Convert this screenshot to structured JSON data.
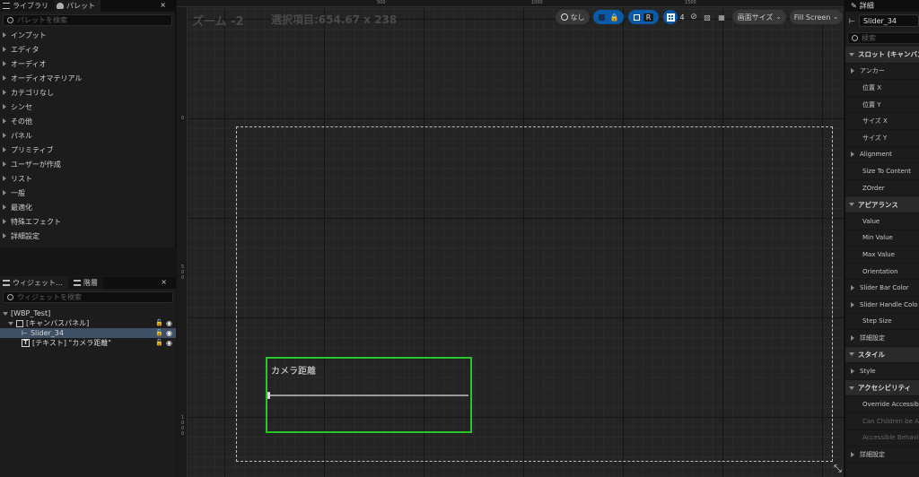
{
  "left_panel": {
    "tabs": {
      "library": "ライブラリ",
      "palette": "パレット",
      "close": "×"
    },
    "search_placeholder": "パレットを検索",
    "categories": [
      "インプット",
      "エディタ",
      "オーディオ",
      "オーディオマテリアル",
      "カテゴリなし",
      "シンセ",
      "その他",
      "パネル",
      "プリミティブ",
      "ユーザーが作成",
      "リスト",
      "一般",
      "最適化",
      "特殊エフェクト",
      "詳細設定"
    ]
  },
  "hierarchy_panel": {
    "tabs": {
      "widgets": "ウィジェット…",
      "hierarchy": "階層",
      "close": "×"
    },
    "search_placeholder": "ウィジェットを検索",
    "tree": {
      "root": "[WBP_Test]",
      "canvas": "[キャンバスパネル]",
      "slider": "Slider_34",
      "text": "[テキスト] \"カメラ距離\""
    }
  },
  "designer": {
    "zoom": "ズーム -2",
    "selection": "選択項目:654.67 x 238",
    "ruler_top": [
      "500",
      "1000",
      "1500"
    ],
    "ruler_left": [
      "0",
      "500",
      "1000"
    ],
    "toolbar": {
      "none": "なし",
      "r": "R",
      "grid_count": "4",
      "screen_size": "画面サイズ",
      "fill_screen": "Fill Screen"
    },
    "widget_text": "カメラ距離",
    "slider_value": 0
  },
  "details_panel": {
    "title": "詳細",
    "name": "Slider_34",
    "search_placeholder": "検索",
    "rows": [
      {
        "type": "sec",
        "label": "スロット (キャンバス"
      },
      {
        "type": "exp",
        "label": "アンカー"
      },
      {
        "type": "prop",
        "label": "位置 X"
      },
      {
        "type": "prop",
        "label": "位置 Y"
      },
      {
        "type": "prop",
        "label": "サイズ X"
      },
      {
        "type": "prop",
        "label": "サイズ Y"
      },
      {
        "type": "exp",
        "label": "Alignment"
      },
      {
        "type": "prop",
        "label": "Size To Content"
      },
      {
        "type": "prop",
        "label": "ZOrder"
      },
      {
        "type": "sec",
        "label": "アピアランス"
      },
      {
        "type": "prop",
        "label": "Value"
      },
      {
        "type": "prop",
        "label": "Min Value"
      },
      {
        "type": "prop",
        "label": "Max Value"
      },
      {
        "type": "prop",
        "label": "Orientation"
      },
      {
        "type": "exp",
        "label": "Slider Bar Color"
      },
      {
        "type": "exp",
        "label": "Slider Handle Colo"
      },
      {
        "type": "prop",
        "label": "Step Size"
      },
      {
        "type": "exp",
        "label": "詳細設定"
      },
      {
        "type": "sec",
        "label": "スタイル"
      },
      {
        "type": "exp",
        "label": "Style"
      },
      {
        "type": "sec",
        "label": "アクセシビリティ"
      },
      {
        "type": "prop",
        "label": "Override Accessibi"
      },
      {
        "type": "propdim",
        "label": "Can Children be Ac"
      },
      {
        "type": "propdim",
        "label": "Accessible Behavi"
      },
      {
        "type": "exp",
        "label": "詳細設定"
      }
    ]
  }
}
